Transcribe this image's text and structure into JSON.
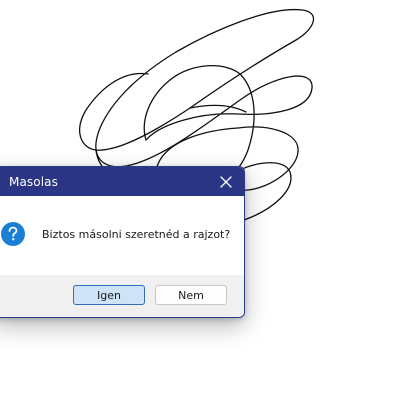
{
  "dialog": {
    "title": "Masolas",
    "message": "Biztos másolni szeretnéd a rajzot?",
    "icon": "question-icon",
    "buttons": {
      "yes_label": "Igen",
      "no_label": "Nem"
    }
  },
  "icons": {
    "close": "close-icon",
    "question": "question-icon"
  },
  "colors": {
    "titlebar": "#2a3585",
    "accent": "#1a7fd4",
    "default_button_bg": "#cfe3f7",
    "default_button_border": "#2d6fb8",
    "footer_bg": "#f0f0f0"
  }
}
